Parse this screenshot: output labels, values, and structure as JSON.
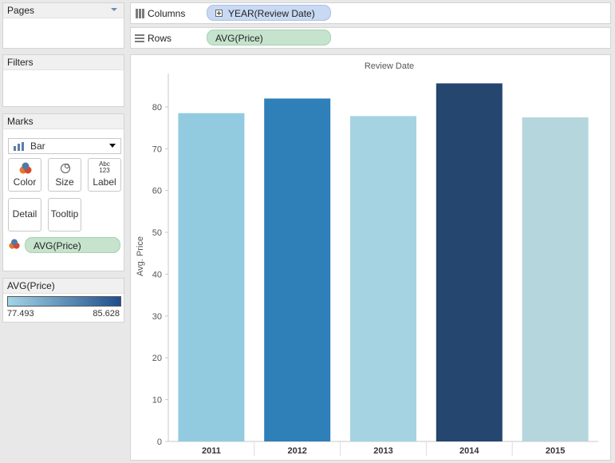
{
  "pages": {
    "title": "Pages"
  },
  "filters": {
    "title": "Filters"
  },
  "marks": {
    "title": "Marks",
    "mark_type": "Bar",
    "buttons": {
      "color": "Color",
      "size": "Size",
      "label": "Label",
      "label_icon_top": "Abc",
      "label_icon_bottom": "123",
      "detail": "Detail",
      "tooltip": "Tooltip"
    },
    "color_pill": "AVG(Price)"
  },
  "legend": {
    "title": "AVG(Price)",
    "min": "77.493",
    "max": "85.628",
    "color_start": "#a3d4e6",
    "color_end": "#1f4e8c"
  },
  "shelves": {
    "columns_label": "Columns",
    "columns_pill": "YEAR(Review Date)",
    "rows_label": "Rows",
    "rows_pill": "AVG(Price)"
  },
  "chart_data": {
    "type": "bar",
    "title": "Review Date",
    "ylabel": "Avg. Price",
    "xlabel": "",
    "categories": [
      "2011",
      "2012",
      "2013",
      "2014",
      "2015"
    ],
    "values": [
      78.5,
      82.0,
      77.8,
      85.628,
      77.493
    ],
    "colors": [
      "#92cbe0",
      "#2f7fb9",
      "#a6d3e2",
      "#24466f",
      "#b5d6dc"
    ],
    "ylim": [
      0,
      88
    ],
    "yticks": [
      0,
      10,
      20,
      30,
      40,
      50,
      60,
      70,
      80
    ],
    "grid": false
  }
}
